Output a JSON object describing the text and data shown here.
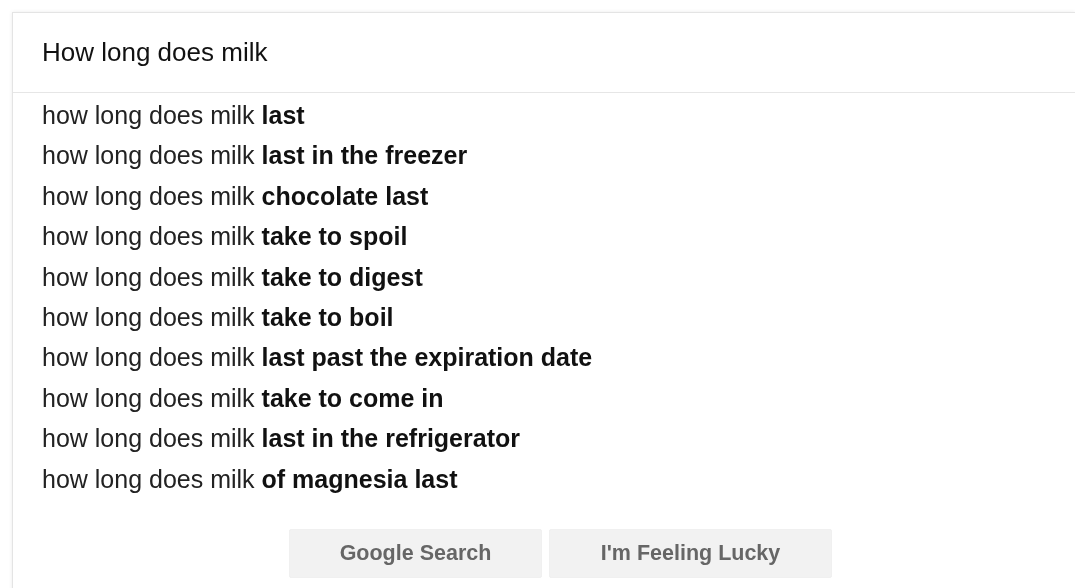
{
  "search": {
    "value": "How long does milk"
  },
  "suggestions": [
    "how long does milk **last**",
    "how long does milk **last in the freezer**",
    "how long does milk **chocolate last**",
    "how long does milk **take to spoil**",
    "how long does milk **take to digest**",
    "how long does milk **take to boil**",
    "how long does milk **last past the expiration date**",
    "how long does milk **take to come in**",
    "how long does milk **last in the refrigerator**",
    "how long does milk **of magnesia last**"
  ],
  "buttons": [
    "Google Search",
    "I'm Feeling Lucky"
  ]
}
